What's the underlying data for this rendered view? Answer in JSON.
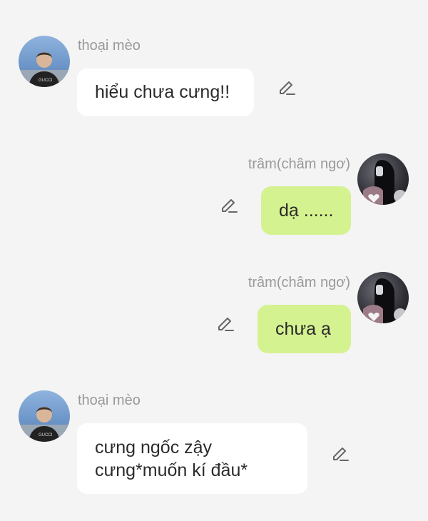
{
  "messages": [
    {
      "sender": "thoại mèo",
      "text": "hiểu chưa cưng!!",
      "direction": "incoming",
      "avatar": "male-avatar"
    },
    {
      "sender": "trâm(châm ngơ)",
      "text": "dạ ......",
      "direction": "outgoing",
      "avatar": "female-avatar"
    },
    {
      "sender": "trâm(châm ngơ)",
      "text": "chưa ạ",
      "direction": "outgoing",
      "avatar": "female-avatar"
    },
    {
      "sender": "thoại mèo",
      "text_lines": [
        "cưng ngốc zậy",
        "cưng*muốn kí đầu*"
      ],
      "direction": "incoming",
      "avatar": "male-avatar"
    }
  ],
  "colors": {
    "background": "#f4f4f4",
    "incoming_bubble": "#ffffff",
    "outgoing_bubble": "#d5f291",
    "sender_name": "#999999",
    "message_text": "#2b2b2b",
    "edit_icon": "#666666"
  },
  "icons": {
    "edit": "pencil-edit-icon"
  }
}
